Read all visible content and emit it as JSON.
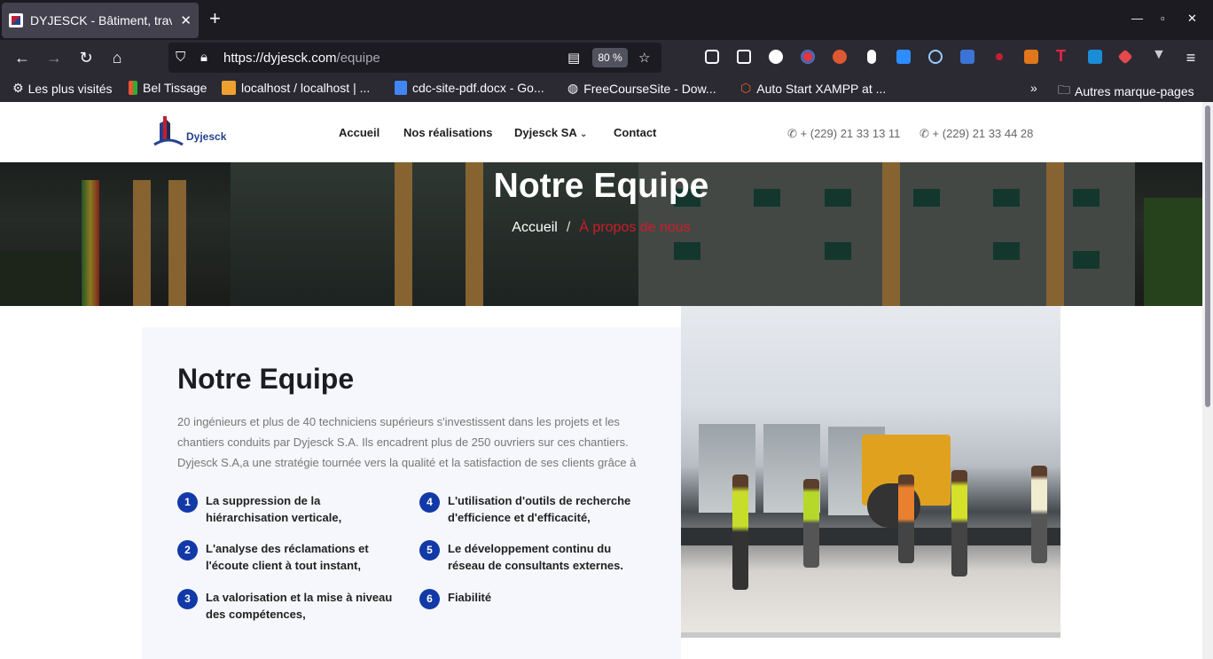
{
  "browser": {
    "tab_title": "DYJESCK - Bâtiment, trav",
    "url_host": "https://dyjesck.com",
    "url_path": "/equipe",
    "zoom": "80 %"
  },
  "bookmarks": [
    {
      "label": "Les plus visités",
      "icon": "gear-icon"
    },
    {
      "label": "Bel Tissage",
      "icon": "h-icon"
    },
    {
      "label": "localhost / localhost | ...",
      "icon": "phpmyadmin-icon"
    },
    {
      "label": "cdc-site-pdf.docx - Go...",
      "icon": "doc-icon"
    },
    {
      "label": "FreeCourseSite - Dow...",
      "icon": "globe-icon"
    },
    {
      "label": "Auto Start XAMPP at ...",
      "icon": "xampp-icon"
    },
    {
      "label": "Autres marque-pages",
      "icon": "folder-icon"
    }
  ],
  "site": {
    "logo_text": "Dyjesck",
    "menu": [
      "Accueil",
      "Nos réalisations",
      "Dyjesck SA",
      "Contact"
    ],
    "phones": [
      "+ (229) 21 33 13 11",
      "+ (229) 21 33 44 28"
    ]
  },
  "hero": {
    "title": "Notre Equipe",
    "crumb_home": "Accueil",
    "crumb_sep": "/",
    "crumb_current": "À propos de nous"
  },
  "content": {
    "title": "Notre Equipe",
    "text": "20 ingénieurs et plus de 40 techniciens supérieurs s'investissent dans les projets et les chantiers conduits par Dyjesck S.A. Ils encadrent plus de 250 ouvriers sur ces chantiers. Dyjesck S.A,a une stratégie tournée vers la qualité et la satisfaction de ses clients grâce à",
    "features": [
      {
        "num": "1",
        "text": "La suppression de la hiérarchisation verticale,"
      },
      {
        "num": "2",
        "text": "L'analyse des réclamations et l'écoute client à tout instant,"
      },
      {
        "num": "3",
        "text": "La valorisation et la mise à niveau des compétences,"
      },
      {
        "num": "4",
        "text": "L'utilisation d'outils de recherche d'efficience et d'efficacité,"
      },
      {
        "num": "5",
        "text": "Le développement continu du réseau de consultants externes."
      },
      {
        "num": "6",
        "text": "Fiabilité"
      }
    ]
  }
}
